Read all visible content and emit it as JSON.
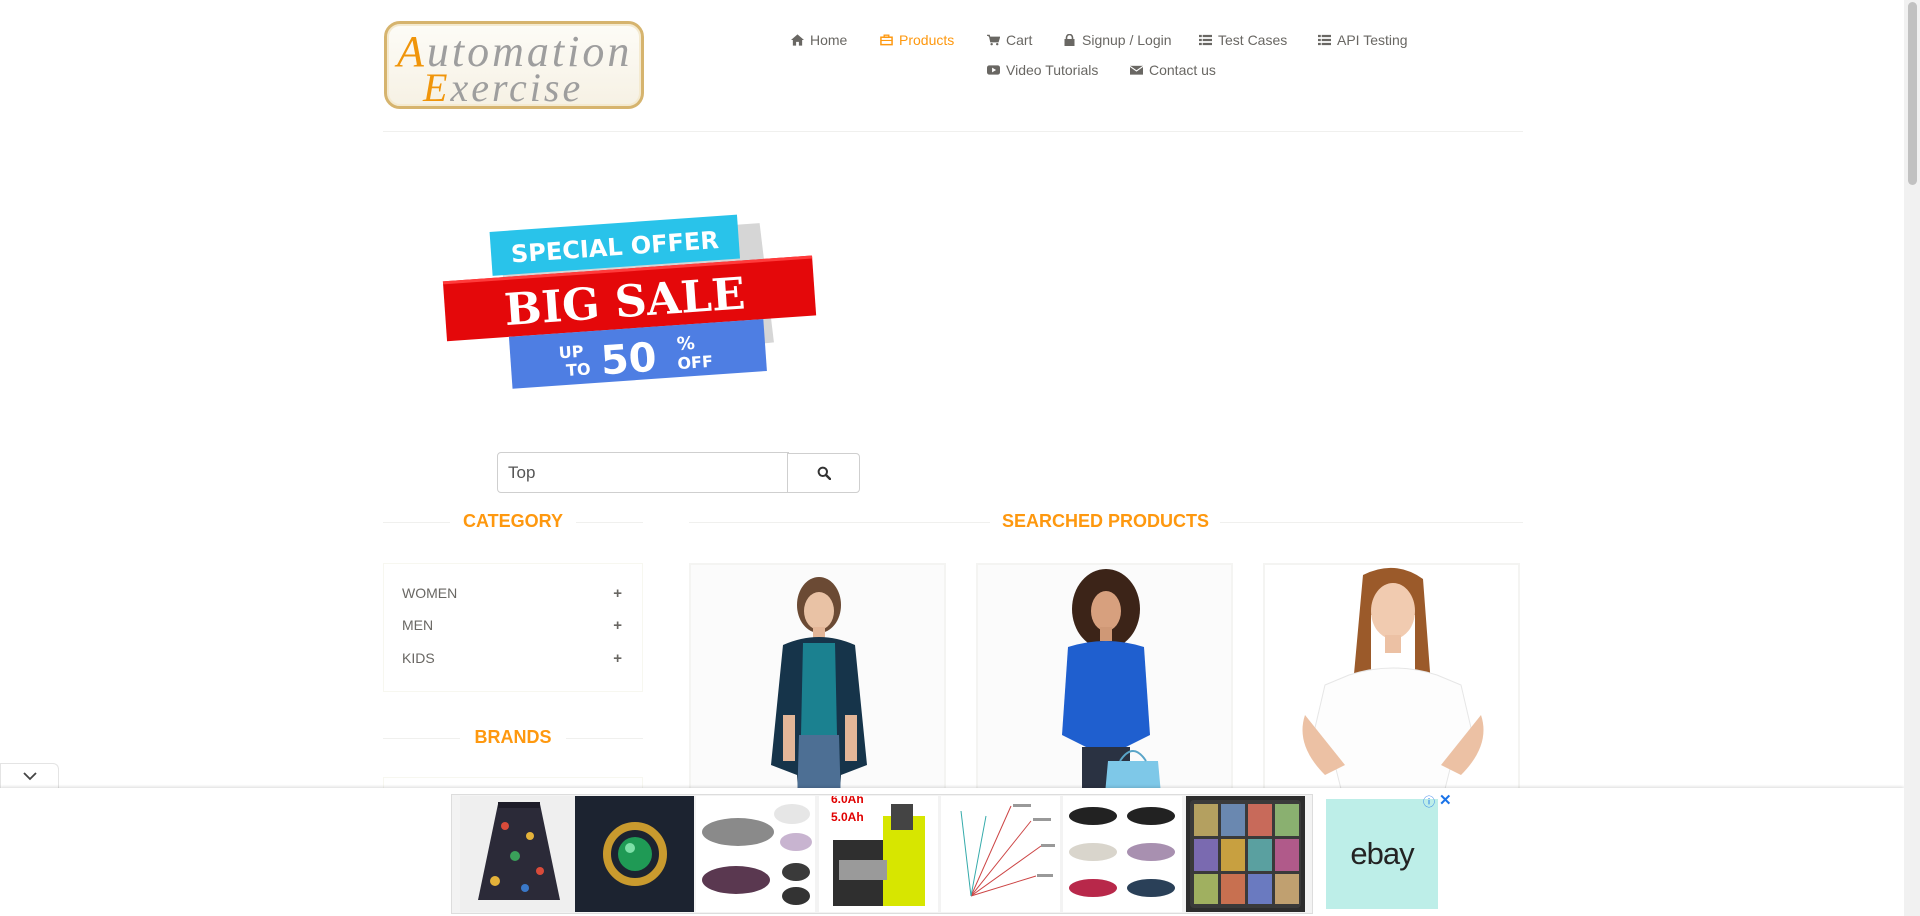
{
  "logo": {
    "line1_cap": "A",
    "line1_rest": "utomation",
    "line2_cap": "E",
    "line2_rest": "xercise"
  },
  "nav": {
    "items": [
      {
        "label": "Home",
        "icon": "home-icon"
      },
      {
        "label": "Products",
        "icon": "products-icon",
        "active": true
      },
      {
        "label": "Cart",
        "icon": "cart-icon"
      },
      {
        "label": "Signup / Login",
        "icon": "lock-icon"
      },
      {
        "label": "Test Cases",
        "icon": "list-icon"
      },
      {
        "label": "API Testing",
        "icon": "list-icon"
      },
      {
        "label": "Video Tutorials",
        "icon": "youtube-icon"
      },
      {
        "label": "Contact us",
        "icon": "envelope-icon"
      }
    ]
  },
  "banner": {
    "line1": "SPECIAL OFFER",
    "line2": "BIG SALE",
    "up": "UP",
    "to": "TO",
    "amount": "50",
    "percent": "%",
    "off": "OFF"
  },
  "search": {
    "value": "Top",
    "button_icon": "search-icon"
  },
  "sidebar": {
    "category_title": "CATEGORY",
    "categories": [
      {
        "label": "WOMEN"
      },
      {
        "label": "MEN"
      },
      {
        "label": "KIDS"
      }
    ],
    "brands_title": "BRANDS"
  },
  "main": {
    "title": "SEARCHED PRODUCTS"
  },
  "ad": {
    "battery_line1": "6.0Ah",
    "battery_line2": "5.0Ah",
    "ebay_label": "ebay",
    "info_icon": "ⓘ",
    "close_icon": "✕"
  },
  "colors": {
    "accent": "#fe980f",
    "text": "#696763",
    "sale_red": "#e4080a",
    "sale_cyan": "#29c3ea",
    "sale_blue": "#4e7ee3",
    "ebay_bg": "#bdeee8"
  }
}
